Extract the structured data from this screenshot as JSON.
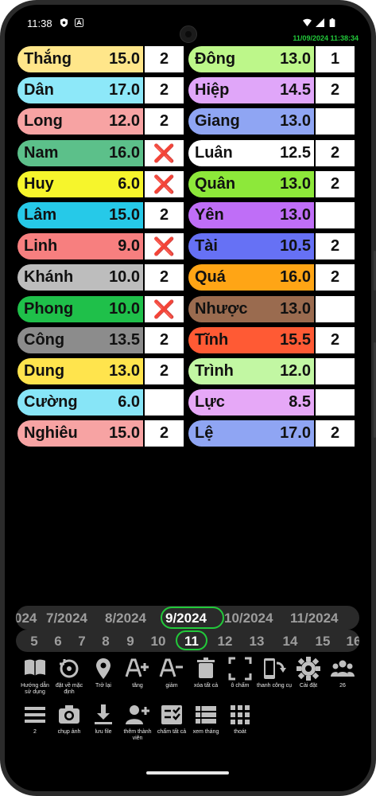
{
  "status_bar": {
    "time": "11:38",
    "datetime": "11/09/2024 11:38:34"
  },
  "left_column": [
    {
      "name": "Thắng",
      "score": "15.0",
      "count": "2",
      "color": "#ffe68a"
    },
    {
      "name": "Dân",
      "score": "17.0",
      "count": "2",
      "color": "#8de8f9"
    },
    {
      "name": "Long",
      "score": "12.0",
      "count": "2",
      "color": "#f7a3a3"
    },
    {
      "name": "Nam",
      "score": "16.0",
      "count": "❌",
      "color": "#5cc08a"
    },
    {
      "name": "Huy",
      "score": "6.0",
      "count": "❌",
      "color": "#f6f52c"
    },
    {
      "name": "Lâm",
      "score": "15.0",
      "count": "2",
      "color": "#26c9e8"
    },
    {
      "name": "Linh",
      "score": "9.0",
      "count": "❌",
      "color": "#f77f7f"
    },
    {
      "name": "Khánh",
      "score": "10.0",
      "count": "2",
      "color": "#bdbdbd"
    },
    {
      "name": "Phong",
      "score": "10.0",
      "count": "❌",
      "color": "#1fc04a"
    },
    {
      "name": "Công",
      "score": "13.5",
      "count": "2",
      "color": "#8c8c8c"
    },
    {
      "name": "Dung",
      "score": "13.0",
      "count": "2",
      "color": "#ffe44d"
    },
    {
      "name": "Cường",
      "score": "6.0",
      "count": "",
      "color": "#87e5f7"
    },
    {
      "name": "Nghiêu",
      "score": "15.0",
      "count": "2",
      "color": "#f7a3a3"
    }
  ],
  "right_column": [
    {
      "name": "Đông",
      "score": "13.0",
      "count": "1",
      "color": "#bdf78a"
    },
    {
      "name": "Hiệp",
      "score": "14.5",
      "count": "2",
      "color": "#e0a6f9"
    },
    {
      "name": "Giang",
      "score": "13.0",
      "count": "",
      "color": "#8fa5f3"
    },
    {
      "name": "Luân",
      "score": "12.5",
      "count": "2",
      "color": "#ffffff"
    },
    {
      "name": "Quân",
      "score": "13.0",
      "count": "2",
      "color": "#8de83a"
    },
    {
      "name": "Yên",
      "score": "13.0",
      "count": "",
      "color": "#bf6ef7"
    },
    {
      "name": "Tài",
      "score": "10.5",
      "count": "2",
      "color": "#6671f5"
    },
    {
      "name": "Quá",
      "score": "16.0",
      "count": "2",
      "color": "#ffa515"
    },
    {
      "name": "Nhược",
      "score": "13.0",
      "count": "",
      "color": "#9a6b4f"
    },
    {
      "name": "Tĩnh",
      "score": "15.5",
      "count": "2",
      "color": "#ff5a34"
    },
    {
      "name": "Trình",
      "score": "12.0",
      "count": "",
      "color": "#c2f7a3"
    },
    {
      "name": "Lực",
      "score": "8.5",
      "count": "",
      "color": "#e6a8f7"
    },
    {
      "name": "Lệ",
      "score": "17.0",
      "count": "2",
      "color": "#8fa5f3"
    }
  ],
  "months": [
    "024",
    "7/2024",
    "8/2024",
    "9/2024",
    "10/2024",
    "11/2024",
    "1"
  ],
  "selected_month": "9/2024",
  "days": [
    "5",
    "6",
    "7",
    "8",
    "9",
    "10",
    "11",
    "12",
    "13",
    "14",
    "15",
    "16"
  ],
  "selected_day": "11",
  "toolbar_row1": [
    {
      "label": "Hướng dẫn sử dụng",
      "icon": "book-icon"
    },
    {
      "label": "đặt về mặc định",
      "icon": "reset-icon"
    },
    {
      "label": "Trở lại",
      "icon": "location-pin-icon"
    },
    {
      "label": "tăng",
      "icon": "font-increase-icon"
    },
    {
      "label": "giảm",
      "icon": "font-decrease-icon"
    },
    {
      "label": "xóa tất cả",
      "icon": "trash-icon"
    },
    {
      "label": "ô chấm",
      "icon": "frame-icon"
    },
    {
      "label": "thanh công cụ",
      "icon": "swap-icon"
    },
    {
      "label": "Cài đặt",
      "icon": "gear-icon"
    },
    {
      "label": "26",
      "icon": "group-icon"
    }
  ],
  "toolbar_row2": [
    {
      "label": "2",
      "icon": "menu-lines-icon"
    },
    {
      "label": "chụp ảnh",
      "icon": "camera-icon"
    },
    {
      "label": "lưu file",
      "icon": "download-icon"
    },
    {
      "label": "thêm thành viên",
      "icon": "person-add-icon"
    },
    {
      "label": "chấm tất cả",
      "icon": "checklist-icon"
    },
    {
      "label": "xem tháng",
      "icon": "list-view-icon"
    },
    {
      "label": "thoát",
      "icon": "apps-grid-icon"
    }
  ]
}
